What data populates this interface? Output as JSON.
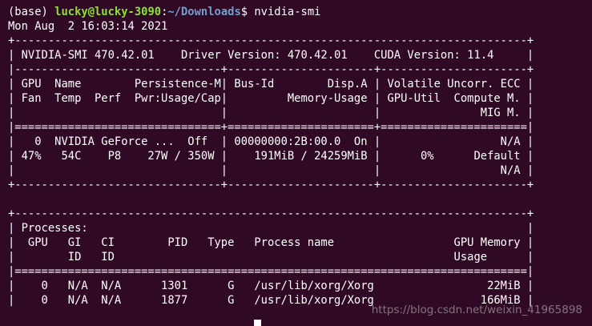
{
  "prompt": {
    "env": "(base) ",
    "user_host": "lucky@lucky-3090",
    "separator": ":",
    "path": "~/Downloads",
    "dollar": "$ ",
    "command": "nvidia-smi"
  },
  "timestamp": "Mon Aug  2 16:03:14 2021",
  "lines": {
    "top_border": "+-----------------------------------------------------------------------------+",
    "header": "| NVIDIA-SMI 470.42.01    Driver Version: 470.42.01    CUDA Version: 11.4     |",
    "sep1": "|-------------------------------+----------------------+----------------------+",
    "colhead1": "| GPU  Name        Persistence-M| Bus-Id        Disp.A | Volatile Uncorr. ECC |",
    "colhead2": "| Fan  Temp  Perf  Pwr:Usage/Cap|         Memory-Usage | GPU-Util  Compute M. |",
    "colhead3": "|                               |                      |               MIG M. |",
    "sep2": "|===============================+======================+======================|",
    "gpu_row1": "|   0  NVIDIA GeForce ...  Off  | 00000000:2B:00.0  On |                  N/A |",
    "gpu_row2": "| 47%   54C    P8    27W / 350W |    191MiB / 24259MiB |      0%      Default |",
    "gpu_row3": "|                               |                      |                  N/A |",
    "bottom_border": "+-------------------------------+----------------------+----------------------+",
    "blank": "",
    "proc_top": "+-----------------------------------------------------------------------------+",
    "proc_title": "| Processes:                                                                  |",
    "proc_head1": "|  GPU   GI   CI        PID   Type   Process name                  GPU Memory |",
    "proc_head2": "|        ID   ID                                                   Usage      |",
    "proc_sep": "|=============================================================================|",
    "proc_row1": "|    0   N/A  N/A      1301      G   /usr/lib/xorg/Xorg                 22MiB |",
    "proc_row2": "|    0   N/A  N/A      1877      G   /usr/lib/xorg/Xorg                166MiB |"
  },
  "watermark": "https://blog.csdn.net/weixin_41965898",
  "colors": {
    "background": "#300a24",
    "foreground": "#ffffff",
    "user_host": "#8ae234",
    "path": "#729fcf"
  }
}
